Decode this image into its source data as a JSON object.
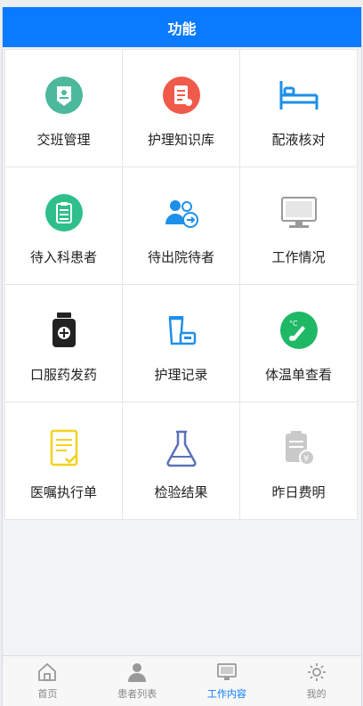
{
  "header": {
    "title": "功能"
  },
  "functions": [
    {
      "label": "交班管理",
      "icon": "handover-icon"
    },
    {
      "label": "护理知识库",
      "icon": "knowledge-base-icon"
    },
    {
      "label": "配液核对",
      "icon": "bed-icon"
    },
    {
      "label": "待入科患者",
      "icon": "clipboard-icon"
    },
    {
      "label": "待出院待者",
      "icon": "discharge-patients-icon"
    },
    {
      "label": "工作情况",
      "icon": "computer-icon"
    },
    {
      "label": "口服药发药",
      "icon": "medicine-bottle-icon"
    },
    {
      "label": "护理记录",
      "icon": "nursing-record-icon"
    },
    {
      "label": "体温单查看",
      "icon": "thermometer-icon"
    },
    {
      "label": "医嘱执行单",
      "icon": "order-sheet-icon"
    },
    {
      "label": "检验结果",
      "icon": "flask-icon"
    },
    {
      "label": "昨日费明",
      "icon": "bill-icon"
    }
  ],
  "tabbar": {
    "items": [
      {
        "label": "首页",
        "icon": "home-icon"
      },
      {
        "label": "患者列表",
        "icon": "person-icon"
      },
      {
        "label": "工作内容",
        "icon": "monitor-icon",
        "active": true
      },
      {
        "label": "我的",
        "icon": "gear-icon"
      }
    ]
  },
  "colors": {
    "primary": "#0a7afe",
    "teal": "#4cb89c",
    "red": "#f05a4a",
    "green": "#2fbf8a",
    "yellow": "#f5d21e"
  }
}
